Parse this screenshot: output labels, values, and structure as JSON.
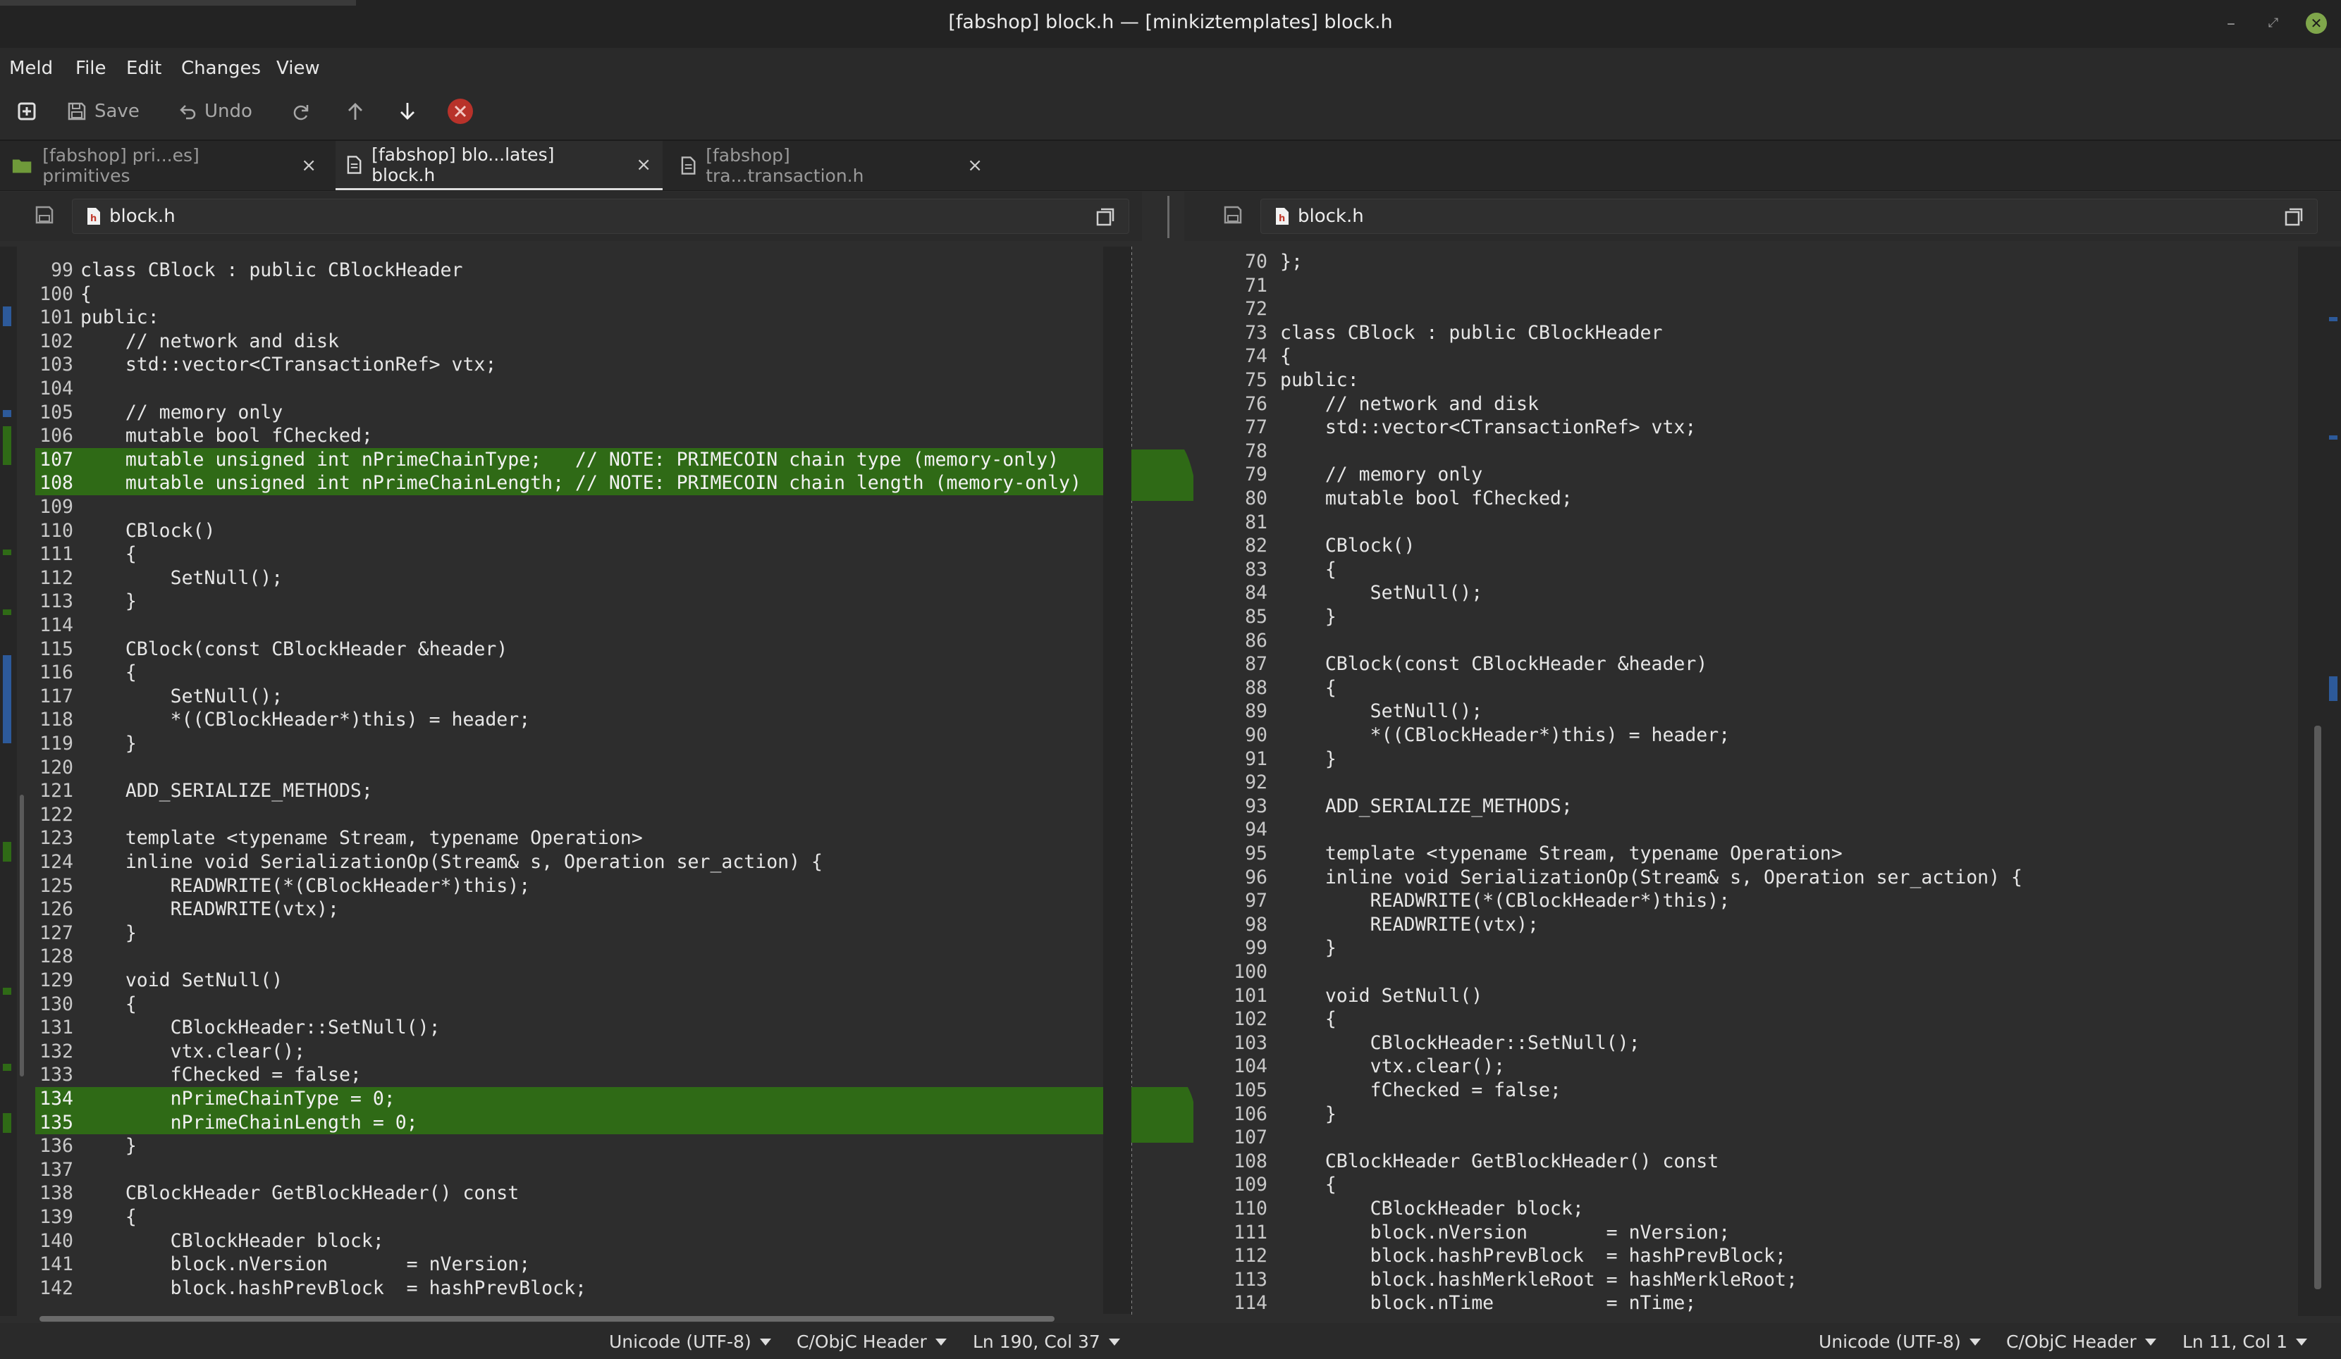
{
  "window": {
    "title": "[fabshop] block.h — [minkiztemplates] block.h"
  },
  "menu": [
    "Meld",
    "File",
    "Edit",
    "Changes",
    "View"
  ],
  "toolbar": {
    "save": "Save",
    "undo": "Undo"
  },
  "tabs": [
    {
      "label": "[fabshop] pri...es] primitives",
      "close": "×"
    },
    {
      "label": "[fabshop] blo...lates] block.h",
      "close": "×"
    },
    {
      "label": "[fabshop] tra...transaction.h",
      "close": "×"
    }
  ],
  "left_pane": {
    "filename": "block.h",
    "lines": [
      {
        "n": "99",
        "t": "class CBlock : public CBlockHeader"
      },
      {
        "n": "100",
        "t": "{"
      },
      {
        "n": "101",
        "t": "public:"
      },
      {
        "n": "102",
        "t": "    // network and disk"
      },
      {
        "n": "103",
        "t": "    std::vector<CTransactionRef> vtx;"
      },
      {
        "n": "104",
        "t": ""
      },
      {
        "n": "105",
        "t": "    // memory only"
      },
      {
        "n": "106",
        "t": "    mutable bool fChecked;"
      },
      {
        "n": "107",
        "t": "    mutable unsigned int nPrimeChainType;   // NOTE: PRIMECOIN chain type (memory-only)",
        "chg": true
      },
      {
        "n": "108",
        "t": "    mutable unsigned int nPrimeChainLength; // NOTE: PRIMECOIN chain length (memory-only)",
        "chg": true
      },
      {
        "n": "109",
        "t": ""
      },
      {
        "n": "110",
        "t": "    CBlock()"
      },
      {
        "n": "111",
        "t": "    {"
      },
      {
        "n": "112",
        "t": "        SetNull();"
      },
      {
        "n": "113",
        "t": "    }"
      },
      {
        "n": "114",
        "t": ""
      },
      {
        "n": "115",
        "t": "    CBlock(const CBlockHeader &header)"
      },
      {
        "n": "116",
        "t": "    {"
      },
      {
        "n": "117",
        "t": "        SetNull();"
      },
      {
        "n": "118",
        "t": "        *((CBlockHeader*)this) = header;"
      },
      {
        "n": "119",
        "t": "    }"
      },
      {
        "n": "120",
        "t": ""
      },
      {
        "n": "121",
        "t": "    ADD_SERIALIZE_METHODS;"
      },
      {
        "n": "122",
        "t": ""
      },
      {
        "n": "123",
        "t": "    template <typename Stream, typename Operation>"
      },
      {
        "n": "124",
        "t": "    inline void SerializationOp(Stream& s, Operation ser_action) {"
      },
      {
        "n": "125",
        "t": "        READWRITE(*(CBlockHeader*)this);"
      },
      {
        "n": "126",
        "t": "        READWRITE(vtx);"
      },
      {
        "n": "127",
        "t": "    }"
      },
      {
        "n": "128",
        "t": ""
      },
      {
        "n": "129",
        "t": "    void SetNull()"
      },
      {
        "n": "130",
        "t": "    {"
      },
      {
        "n": "131",
        "t": "        CBlockHeader::SetNull();"
      },
      {
        "n": "132",
        "t": "        vtx.clear();"
      },
      {
        "n": "133",
        "t": "        fChecked = false;"
      },
      {
        "n": "134",
        "t": "        nPrimeChainType = 0;",
        "chg": true
      },
      {
        "n": "135",
        "t": "        nPrimeChainLength = 0;",
        "chg": true
      },
      {
        "n": "136",
        "t": "    }"
      },
      {
        "n": "137",
        "t": ""
      },
      {
        "n": "138",
        "t": "    CBlockHeader GetBlockHeader() const"
      },
      {
        "n": "139",
        "t": "    {"
      },
      {
        "n": "140",
        "t": "        CBlockHeader block;"
      },
      {
        "n": "141",
        "t": "        block.nVersion       = nVersion;"
      },
      {
        "n": "142",
        "t": "        block.hashPrevBlock  = hashPrevBlock;"
      }
    ]
  },
  "right_pane": {
    "filename": "block.h",
    "lines": [
      {
        "n": "70",
        "t": "};"
      },
      {
        "n": "71",
        "t": ""
      },
      {
        "n": "72",
        "t": ""
      },
      {
        "n": "73",
        "t": "class CBlock : public CBlockHeader"
      },
      {
        "n": "74",
        "t": "{"
      },
      {
        "n": "75",
        "t": "public:"
      },
      {
        "n": "76",
        "t": "    // network and disk"
      },
      {
        "n": "77",
        "t": "    std::vector<CTransactionRef> vtx;"
      },
      {
        "n": "78",
        "t": ""
      },
      {
        "n": "79",
        "t": "    // memory only"
      },
      {
        "n": "80",
        "t": "    mutable bool fChecked;"
      },
      {
        "n": "81",
        "t": ""
      },
      {
        "n": "82",
        "t": "    CBlock()"
      },
      {
        "n": "83",
        "t": "    {"
      },
      {
        "n": "84",
        "t": "        SetNull();"
      },
      {
        "n": "85",
        "t": "    }"
      },
      {
        "n": "86",
        "t": ""
      },
      {
        "n": "87",
        "t": "    CBlock(const CBlockHeader &header)"
      },
      {
        "n": "88",
        "t": "    {"
      },
      {
        "n": "89",
        "t": "        SetNull();"
      },
      {
        "n": "90",
        "t": "        *((CBlockHeader*)this) = header;"
      },
      {
        "n": "91",
        "t": "    }"
      },
      {
        "n": "92",
        "t": ""
      },
      {
        "n": "93",
        "t": "    ADD_SERIALIZE_METHODS;"
      },
      {
        "n": "94",
        "t": ""
      },
      {
        "n": "95",
        "t": "    template <typename Stream, typename Operation>"
      },
      {
        "n": "96",
        "t": "    inline void SerializationOp(Stream& s, Operation ser_action) {"
      },
      {
        "n": "97",
        "t": "        READWRITE(*(CBlockHeader*)this);"
      },
      {
        "n": "98",
        "t": "        READWRITE(vtx);"
      },
      {
        "n": "99",
        "t": "    }"
      },
      {
        "n": "100",
        "t": ""
      },
      {
        "n": "101",
        "t": "    void SetNull()"
      },
      {
        "n": "102",
        "t": "    {"
      },
      {
        "n": "103",
        "t": "        CBlockHeader::SetNull();"
      },
      {
        "n": "104",
        "t": "        vtx.clear();"
      },
      {
        "n": "105",
        "t": "        fChecked = false;"
      },
      {
        "n": "106",
        "t": "    }"
      },
      {
        "n": "107",
        "t": ""
      },
      {
        "n": "108",
        "t": "    CBlockHeader GetBlockHeader() const"
      },
      {
        "n": "109",
        "t": "    {"
      },
      {
        "n": "110",
        "t": "        CBlockHeader block;"
      },
      {
        "n": "111",
        "t": "        block.nVersion       = nVersion;"
      },
      {
        "n": "112",
        "t": "        block.hashPrevBlock  = hashPrevBlock;"
      },
      {
        "n": "113",
        "t": "        block.hashMerkleRoot = hashMerkleRoot;"
      },
      {
        "n": "114",
        "t": "        block.nTime          = nTime;"
      }
    ]
  },
  "status_left": {
    "encoding": "Unicode (UTF-8)",
    "language": "C/ObjC Header",
    "position": "Ln 190, Col 37"
  },
  "status_right": {
    "encoding": "Unicode (UTF-8)",
    "language": "C/ObjC Header",
    "position": "Ln 11, Col 1"
  },
  "colors": {
    "change": "#2f6a16",
    "bg": "#2d2d2d",
    "close_toolbar": "#b8322a"
  }
}
